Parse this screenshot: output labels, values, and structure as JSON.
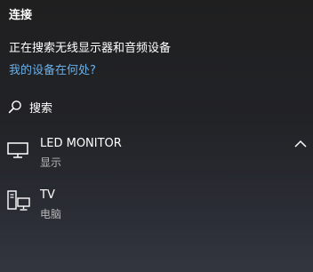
{
  "panel": {
    "title": "连接",
    "status_text": "正在搜索无线显示器和音频设备",
    "help_link": "我的设备在何处?",
    "search_label": "搜索"
  },
  "devices": [
    {
      "name": "LED MONITOR",
      "type": "显示",
      "icon": "monitor-icon",
      "expanded": true
    },
    {
      "name": "TV",
      "type": "电脑",
      "icon": "computer-icon"
    }
  ],
  "colors": {
    "link": "#6ab0ea",
    "secondary_text": "#b8b8b8"
  }
}
